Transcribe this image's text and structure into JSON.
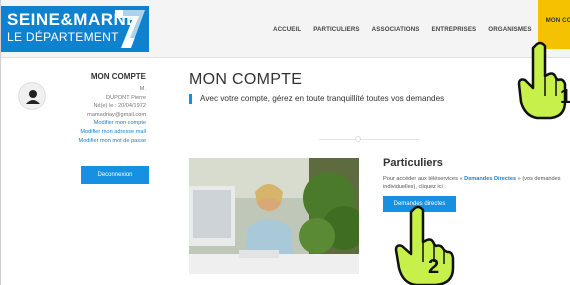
{
  "logo": {
    "line1": "SEINE&MARNE",
    "line2": "LE DÉPARTEMENT",
    "brand_color": "#0e82cf"
  },
  "nav": {
    "items": [
      "ACCUEIL",
      "PARTICULIERS",
      "ASSOCIATIONS",
      "ENTREPRISES",
      "ORGANISMES",
      "MON COMPTE"
    ],
    "active": "MON COMPTE",
    "active_color": "#f5c200"
  },
  "sidebar": {
    "title": "MON COMPTE",
    "user_initial": "M.",
    "user_name": "DUPONT Pierre",
    "birth": "Né(e) le : 20/04/1972",
    "email": "mamadriay@gmail.com",
    "links": [
      "Modifier mon compte",
      "Modifier mon adresse mail",
      "Modifier mon mot de passe"
    ],
    "logout_label": "Deconnexion",
    "avatar_icon": "user-icon"
  },
  "main": {
    "title": "MON COMPTE",
    "subtitle": "Avec votre compte, gérez en toute tranquillité toutes vos demandes"
  },
  "particuliers": {
    "title": "Particuliers",
    "text_before": "Pour accéder aux téléservices « ",
    "text_link": "Demandes Directes",
    "text_after": " » (vos demandes individuelles), cliquez ici :",
    "button_label": "Demandes directes"
  },
  "annotations": {
    "step1": "1",
    "step2": "2",
    "hand_icon": "pointing-hand-icon",
    "hand_color": "#c8f04a"
  },
  "colors": {
    "accent": "#1690e0",
    "link": "#1a7fd0"
  }
}
